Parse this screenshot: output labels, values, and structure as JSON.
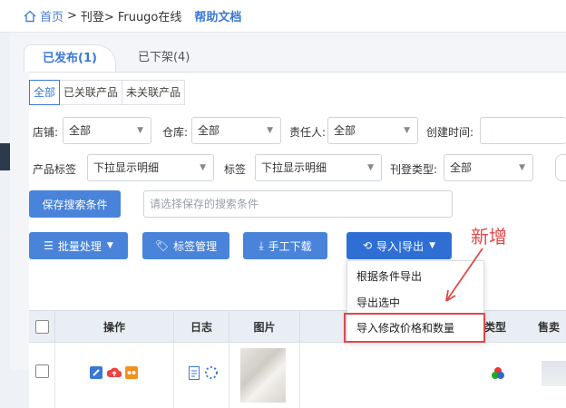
{
  "breadcrumb": {
    "home": "首页",
    "sep1": ">",
    "level2": "刊登>",
    "level3": "Fruugo在线",
    "help": "帮助文档"
  },
  "tabs": [
    {
      "label": "已发布(1)",
      "active": true
    },
    {
      "label": "已下架(4)",
      "active": false
    }
  ],
  "link_filter": [
    "全部",
    "已关联产品",
    "未关联产品"
  ],
  "filters": {
    "shop_label": "店铺:",
    "shop_value": "全部",
    "warehouse_label": "仓库:",
    "warehouse_value": "全部",
    "owner_label": "责任人:",
    "owner_value": "全部",
    "created_label": "创建时间:",
    "product_tag_label": "产品标签",
    "product_tag_value": "下拉显示明细",
    "tag_label": "标签",
    "tag_value": "下拉显示明细",
    "listing_type_label": "刊登类型:",
    "listing_type_value": "全部"
  },
  "save_search_button": "保存搜索条件",
  "saved_search_placeholder": "请选择保存的搜索条件",
  "toolbar": {
    "batch": "批量处理",
    "tags": "标签管理",
    "download": "手工下载",
    "import_export": "导入|导出"
  },
  "dropdown_items": [
    "根据条件导出",
    "导出选中",
    "导入修改价格和数量"
  ],
  "annotation": "新增",
  "table": {
    "headers": [
      "操作",
      "日志",
      "图片",
      "类型",
      "售卖"
    ]
  },
  "colors": {
    "accent": "#4a84da",
    "annotation": "#e0484a"
  }
}
